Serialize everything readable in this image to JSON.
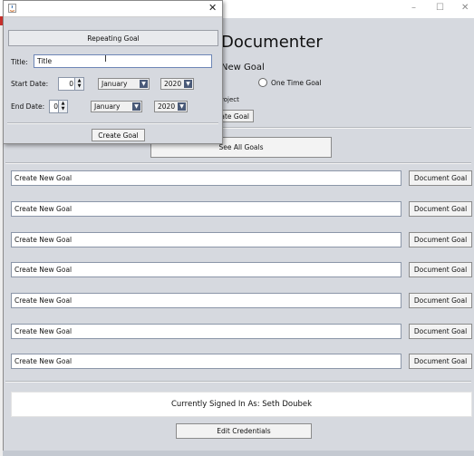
{
  "main": {
    "title": "Documenter",
    "new_goal_heading": "New Goal",
    "one_time_goal_label": "One Time Goal",
    "project_label_fragment": "roject",
    "create_goal_fragment": "eate Goal",
    "see_all_goals_label": "See All Goals",
    "goal_rows": [
      {
        "field_value": "Create New Goal",
        "button_label": "Document Goal"
      },
      {
        "field_value": "Create New Goal",
        "button_label": "Document Goal"
      },
      {
        "field_value": "Create New Goal",
        "button_label": "Document Goal"
      },
      {
        "field_value": "Create New Goal",
        "button_label": "Document Goal"
      },
      {
        "field_value": "Create New Goal",
        "button_label": "Document Goal"
      },
      {
        "field_value": "Create New Goal",
        "button_label": "Document Goal"
      },
      {
        "field_value": "Create New Goal",
        "button_label": "Document Goal"
      }
    ],
    "signed_in_text": "Currently Signed In As: Seth Doubek",
    "edit_credentials_label": "Edit Credentials",
    "window_controls": {
      "minimize": "–",
      "maximize": "☐",
      "close": "✕"
    }
  },
  "dialog": {
    "close_glyph": "✕",
    "header_label": "Repeating Goal",
    "title_label": "Title:",
    "title_value": "Title",
    "start_date_label": "Start Date:",
    "start_day": "0",
    "start_month": "January",
    "start_year": "2020",
    "end_date_label": "End Date:",
    "end_day": "0",
    "end_month": "January",
    "end_year": "2020",
    "create_goal_label": "Create Goal"
  },
  "icons": {
    "dialog_icon": "java-app-icon",
    "dropdown": "chevron-down-icon",
    "spinner": "spinner-arrows-icon",
    "cursor": "text-cursor-icon"
  },
  "colors": {
    "panel_bg": "#d6d9df",
    "field_border": "#6d86b6",
    "dropdown_arrow": "#4a5a78"
  }
}
